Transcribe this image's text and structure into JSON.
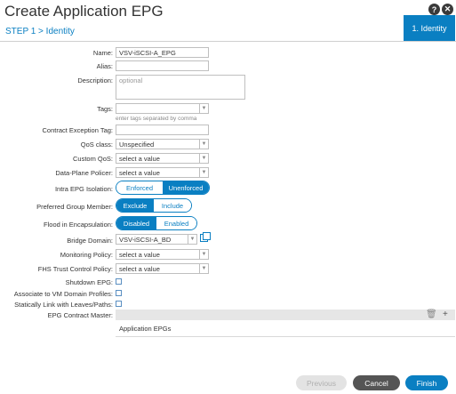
{
  "header": {
    "title": "Create Application EPG",
    "step": "STEP 1 > Identity",
    "step_box": "1. Identity",
    "help_glyph": "?",
    "close_glyph": "✕"
  },
  "form": {
    "name": {
      "label": "Name:",
      "value": "VSV-iSCSI-A_EPG"
    },
    "alias": {
      "label": "Alias:",
      "value": ""
    },
    "description": {
      "label": "Description:",
      "placeholder": "optional"
    },
    "tags": {
      "label": "Tags:",
      "hint": "enter tags separated by comma"
    },
    "contract_exception_tag": {
      "label": "Contract Exception Tag:",
      "value": ""
    },
    "qos_class": {
      "label": "QoS class:",
      "value": "Unspecified"
    },
    "custom_qos": {
      "label": "Custom QoS:",
      "value": "select a value"
    },
    "data_plane_policer": {
      "label": "Data-Plane Policer:",
      "value": "select a value"
    },
    "intra_epg_isolation": {
      "label": "Intra EPG Isolation:",
      "options": [
        "Enforced",
        "Unenforced"
      ],
      "selected": "Unenforced"
    },
    "preferred_group_member": {
      "label": "Preferred Group Member:",
      "options": [
        "Exclude",
        "Include"
      ],
      "selected": "Exclude"
    },
    "flood_in_encapsulation": {
      "label": "Flood in Encapsulation:",
      "options": [
        "Disabled",
        "Enabled"
      ],
      "selected": "Disabled"
    },
    "bridge_domain": {
      "label": "Bridge Domain:",
      "value": "VSV-iSCSI-A_BD"
    },
    "monitoring_policy": {
      "label": "Monitoring Policy:",
      "value": "select a value"
    },
    "fhs_trust_control_policy": {
      "label": "FHS Trust Control Policy:",
      "value": "select a value"
    },
    "shutdown_epg": {
      "label": "Shutdown EPG:"
    },
    "associate_vm_domain": {
      "label": "Associate to VM Domain Profiles:"
    },
    "static_link": {
      "label": "Statically Link with Leaves/Paths:"
    },
    "epg_contract_master": {
      "label": "EPG Contract Master:",
      "column_header": "Application EPGs"
    }
  },
  "footer": {
    "previous": "Previous",
    "cancel": "Cancel",
    "finish": "Finish"
  },
  "colors": {
    "accent": "#0a7fc2",
    "cancel": "#555555",
    "disabled": "#e3e3e3"
  }
}
